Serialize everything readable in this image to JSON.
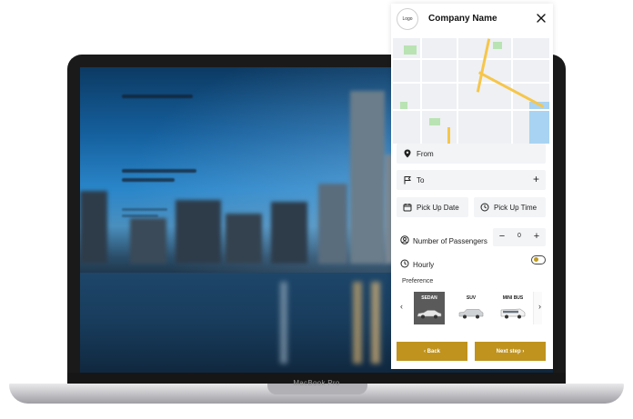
{
  "laptop": {
    "brand": "MacBook Pro"
  },
  "panel": {
    "logo": "Logo",
    "company_name": "Company Name",
    "from_label": "From",
    "to_label": "To",
    "pickup_date_label": "Pick Up Date",
    "pickup_time_label": "Pick Up Time",
    "passengers_label": "Number of Passengers",
    "passengers_value": "0",
    "minus": "−",
    "plus": "+",
    "hourly_label": "Hourly",
    "hourly_on": false,
    "preference_label": "Preference",
    "vehicles": [
      {
        "name": "SEDAN",
        "selected": true
      },
      {
        "name": "SUV",
        "selected": false
      },
      {
        "name": "MINI BUS",
        "selected": false
      }
    ],
    "prev_arrow": "‹",
    "next_arrow": "›",
    "back_label": "‹  Back",
    "next_label": "Next step  ›"
  },
  "colors": {
    "accent": "#bf931e",
    "field_bg": "#f3f4f6",
    "selected_card": "#5a5a5a"
  },
  "icons": [
    "close-icon",
    "location-pin-icon",
    "flag-icon",
    "plus-icon",
    "calendar-icon",
    "clock-icon",
    "user-circle-icon",
    "chevron-left-icon",
    "chevron-right-icon",
    "car-icon"
  ]
}
